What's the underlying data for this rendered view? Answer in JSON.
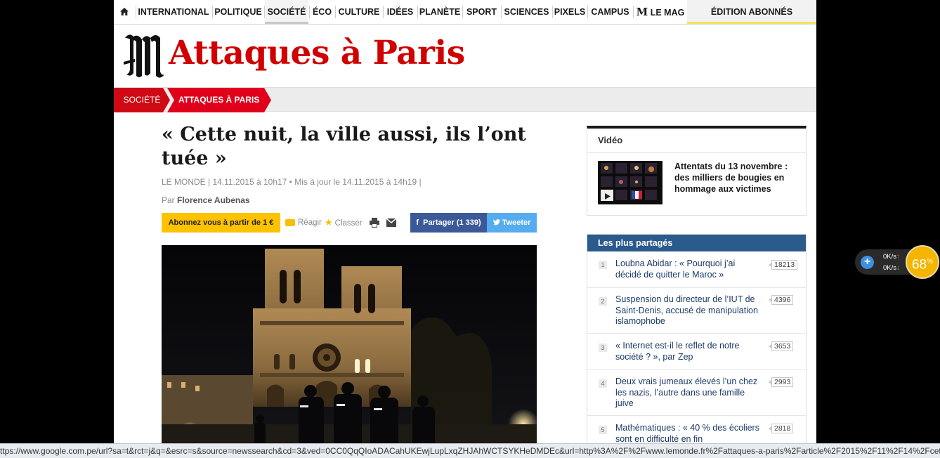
{
  "nav": {
    "items": [
      "INTERNATIONAL",
      "POLITIQUE",
      "SOCIÉTÉ",
      "ÉCO",
      "CULTURE",
      "IDÉES",
      "PLANÈTE",
      "SPORT",
      "SCIENCES",
      "PIXELS",
      "CAMPUS"
    ],
    "lemag_mark": "M",
    "lemag_label": "LE MAG",
    "abonnes": "ÉDITION ABONNÉS"
  },
  "masthead": {
    "title": "Attaques à Paris"
  },
  "breadcrumb": [
    "SOCIÉTÉ",
    "ATTAQUES À PARIS"
  ],
  "article": {
    "headline": "« Cette nuit, la ville aussi, ils l’ont tuée »",
    "meta": "LE MONDE | 14.11.2015 à 10h17 • Mis à jour le 14.11.2015 à 14h19 |",
    "byline_prefix": "Par ",
    "author": "Florence Aubenas",
    "subscribe_btn": "Abonnez vous à partir de 1 €",
    "react_btn": "Réagir",
    "save_btn": "Classer",
    "share_btn": "Partager (1 339)",
    "share_icon": "f",
    "tweet_btn": "Tweeter"
  },
  "sidebar": {
    "video": {
      "label": "Vidéo",
      "title": "Attentats du 13 novembre : des milliers de bougies en hommage aux victimes"
    },
    "most_shared": {
      "header": "Les plus partagés",
      "items": [
        {
          "rank": "1",
          "title": "Loubna Abidar : « Pourquoi j’ai décidé de quitter le Maroc »",
          "count": "18213"
        },
        {
          "rank": "2",
          "title": "Suspension du directeur de l’IUT de Saint-Denis, accusé de manipulation islamophobe",
          "count": "4396"
        },
        {
          "rank": "3",
          "title": "« Internet est-il le reflet de notre société ? », par Zep",
          "count": "3653"
        },
        {
          "rank": "4",
          "title": "Deux vrais jumeaux élevés l’un chez les nazis, l’autre dans une famille juive",
          "count": "2993"
        },
        {
          "rank": "5",
          "title": "Mathématiques : « 40 % des écoliers sont en difficulté en fin",
          "count": "2818"
        }
      ]
    }
  },
  "speed_widget": {
    "up": "0K/s",
    "down": "0K/s",
    "percent": "68",
    "unit": "%"
  },
  "status_url": "ttps://www.google.com.pe/url?sa=t&rct=j&q=&esrc=s&source=newssearch&cd=3&ved=0CC0QqQIoADACahUKEwjLupLxqZHJAhWCTSYKHeDMDEc&url=http%3A%2F%2Fwww.lemonde.fr%2Fattaques-a-paris%2Farticle%2F2015%2F11%2F14%2Fcet...",
  "colors": {
    "brand_red": "#d00000",
    "breadcrumb_red": "#e0001a",
    "facebook": "#3b5998",
    "twitter": "#55acee",
    "subscribe": "#ffc200",
    "sidebar_header": "#2b5a8c"
  }
}
